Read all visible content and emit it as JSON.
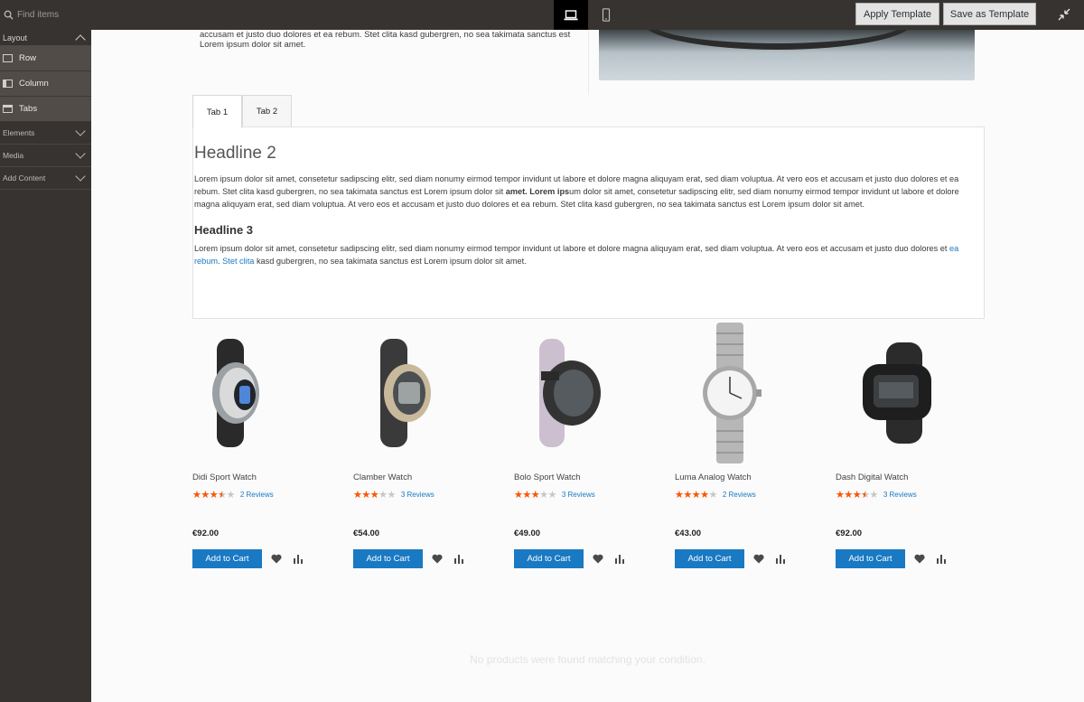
{
  "toolbar": {
    "search_placeholder": "Find items",
    "apply_template": "Apply Template",
    "save_as_template": "Save as Template"
  },
  "sidebar": {
    "layout_label": "Layout",
    "layout_items": [
      {
        "label": "Row",
        "icon": "row-icon"
      },
      {
        "label": "Column",
        "icon": "column-icon"
      },
      {
        "label": "Tabs",
        "icon": "tabs-icon"
      }
    ],
    "sections": [
      {
        "label": "Elements"
      },
      {
        "label": "Media"
      },
      {
        "label": "Add Content"
      }
    ]
  },
  "stage": {
    "column_text": "accusam et justo duo dolores et ea rebum. Stet clita kasd gubergren, no sea takimata sanctus est Lorem ipsum dolor sit amet.",
    "tabs": [
      {
        "label": "Tab 1",
        "active": true
      },
      {
        "label": "Tab 2",
        "active": false
      }
    ],
    "headline2": "Headline 2",
    "para1_a": "Lorem ipsum dolor sit amet, consetetur sadipscing elitr, sed diam nonumy eirmod tempor invidunt ut labore et dolore magna aliquyam erat, sed diam voluptua. At vero eos et accusam et justo duo dolores et ea rebum. Stet clita kasd gubergren, no sea takimata sanctus est Lorem ipsum dolor sit ",
    "para1_bold": "amet. Lorem ips",
    "para1_b": "um dolor sit amet, consetetur sadipscing elitr, sed diam nonumy eirmod tempor invidunt ut labore et dolore magna aliquyam erat, sed diam voluptua. At vero eos et accusam et justo duo dolores et ea rebum. Stet clita kasd gubergren, no sea takimata sanctus est Lorem ipsum dolor sit amet.",
    "headline3": "Headline 3",
    "para2_a": "Lorem ipsum dolor sit amet, consetetur sadipscing elitr, sed diam nonumy eirmod tempor invidunt ut labore et dolore magna aliquyam erat, sed diam voluptua. At vero eos et accusam et justo duo dolores et ",
    "para2_link1": "ea rebum",
    "para2_sep": ". ",
    "para2_link2": "Stet clita",
    "para2_b": " kasd gubergren, no sea takimata sanctus est Lorem ipsum dolor sit amet.",
    "no_products": "No products were found matching your condition."
  },
  "products": [
    {
      "name": "Didi Sport Watch",
      "rating_pct": 70,
      "reviews": "2  Reviews",
      "price": "€92.00"
    },
    {
      "name": "Clamber Watch",
      "rating_pct": 60,
      "reviews": "3  Reviews",
      "price": "€54.00"
    },
    {
      "name": "Bolo Sport Watch",
      "rating_pct": 60,
      "reviews": "3  Reviews",
      "price": "€49.00"
    },
    {
      "name": "Luma Analog Watch",
      "rating_pct": 80,
      "reviews": "2  Reviews",
      "price": "€43.00"
    },
    {
      "name": "Dash Digital Watch",
      "rating_pct": 70,
      "reviews": "3  Reviews",
      "price": "€92.00"
    }
  ],
  "add_to_cart_label": "Add to Cart",
  "colors": {
    "chrome": "#373330",
    "accent_blue": "#1979c3",
    "star_orange": "#ff5501"
  }
}
